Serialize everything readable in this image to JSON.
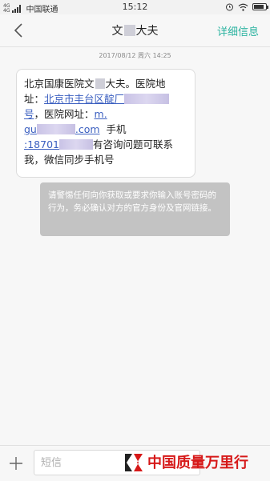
{
  "status_bar": {
    "signal_label": "4G",
    "signal_label2": "4G",
    "carrier": "中国联通",
    "time": "15:12",
    "battery_level": 0.85
  },
  "header": {
    "contact_name_prefix": "文",
    "contact_name_suffix": "大夫",
    "details_label": "详细信息"
  },
  "conversation": {
    "timestamp": "2017/08/12 周六 14:25",
    "message": {
      "line1": "北京国康医院文",
      "line1b": "大夫。医院地",
      "line2_prefix": "址：",
      "line2_link": "北京市丰台区靛厂",
      "line3_link": "号",
      "line3_rest": "，医院网址：",
      "line3_link2": "m.",
      "line4_link_a": "gu",
      "line4_link_b": ".com",
      "line4_rest": "手机",
      "line5_link": ":18701",
      "line5_rest": "有咨询问题可联系",
      "line6": "我，微信同步手机号"
    },
    "warning": "请警惕任何向你获取或要求你输入账号密码的行为，务必确认对方的官方身份及官网链接。"
  },
  "compose": {
    "placeholder": "短信"
  },
  "watermark": {
    "text": "中国质量万里行"
  }
}
